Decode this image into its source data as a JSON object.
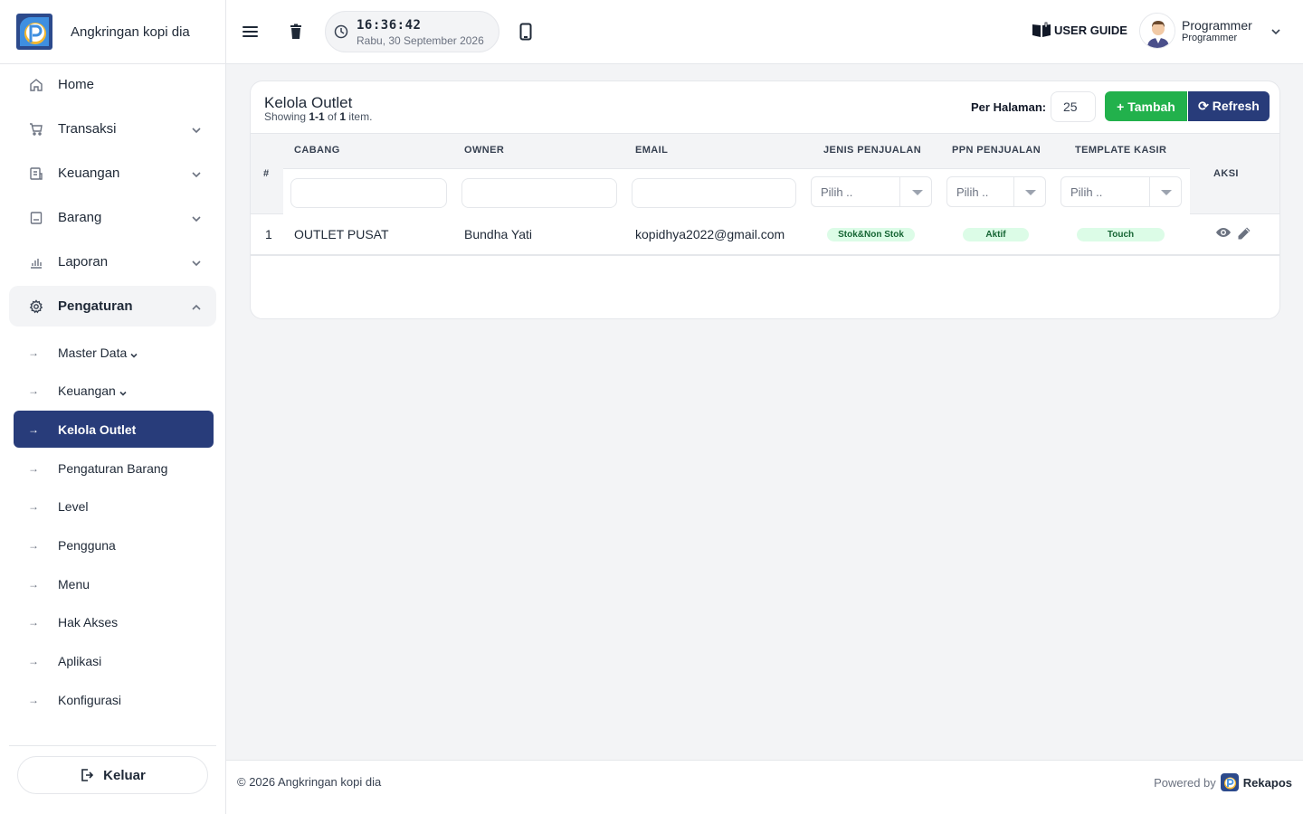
{
  "app": {
    "brand_name": "Angkringan kopi dia"
  },
  "sidebar": {
    "items": [
      {
        "label": "Home"
      },
      {
        "label": "Transaksi"
      },
      {
        "label": "Keuangan"
      },
      {
        "label": "Barang"
      },
      {
        "label": "Laporan"
      },
      {
        "label": "Pengaturan"
      }
    ],
    "submenu": [
      {
        "label": "Master Data"
      },
      {
        "label": "Keuangan"
      },
      {
        "label": "Kelola Outlet"
      },
      {
        "label": "Pengaturan Barang"
      },
      {
        "label": "Level"
      },
      {
        "label": "Pengguna"
      },
      {
        "label": "Menu"
      },
      {
        "label": "Hak Akses"
      },
      {
        "label": "Aplikasi"
      },
      {
        "label": "Konfigurasi"
      }
    ],
    "active_submenu": "Kelola Outlet",
    "logout_label": "Keluar"
  },
  "topbar": {
    "time": "16:36:42",
    "date": "Rabu, 30 September 2026",
    "guide_label": "USER GUIDE",
    "user_name": "Programmer",
    "user_role": "Programmer"
  },
  "card": {
    "title": "Kelola Outlet",
    "showing_prefix": "Showing ",
    "showing_range": "1-1",
    "showing_of": " of ",
    "showing_total": "1",
    "showing_suffix": " item.",
    "per_page_label": "Per Halaman:",
    "per_page_value": "25",
    "add_label": "+ Tambah",
    "refresh_label": "⟳ Refresh"
  },
  "table": {
    "columns": {
      "num": "#",
      "cabang": "CABANG",
      "owner": "OWNER",
      "email": "EMAIL",
      "jenis": "JENIS PENJUALAN",
      "ppn": "PPN PENJUALAN",
      "template": "TEMPLATE KASIR",
      "aksi": "AKSI"
    },
    "filter_placeholder": "Pilih ..",
    "rows": [
      {
        "num": "1",
        "cabang": "OUTLET PUSAT",
        "owner": "Bundha Yati",
        "email": "kopidhya2022@gmail.com",
        "jenis": "Stok&Non Stok",
        "ppn": "Aktif",
        "template": "Touch"
      }
    ]
  },
  "footer": {
    "copyright": "© 2026 Angkringan kopi dia",
    "powered_by": "Powered by",
    "powered_brand": "Rekapos"
  },
  "colors": {
    "primary": "#283c7a",
    "success": "#22b14c",
    "badge_bg": "#dcfce7",
    "badge_text": "#166534"
  },
  "icons": {
    "home": "home-icon",
    "transaksi": "cart-icon",
    "keuangan": "receipt-icon",
    "barang": "box-icon",
    "laporan": "bar-chart-icon",
    "pengaturan": "gear-icon"
  }
}
